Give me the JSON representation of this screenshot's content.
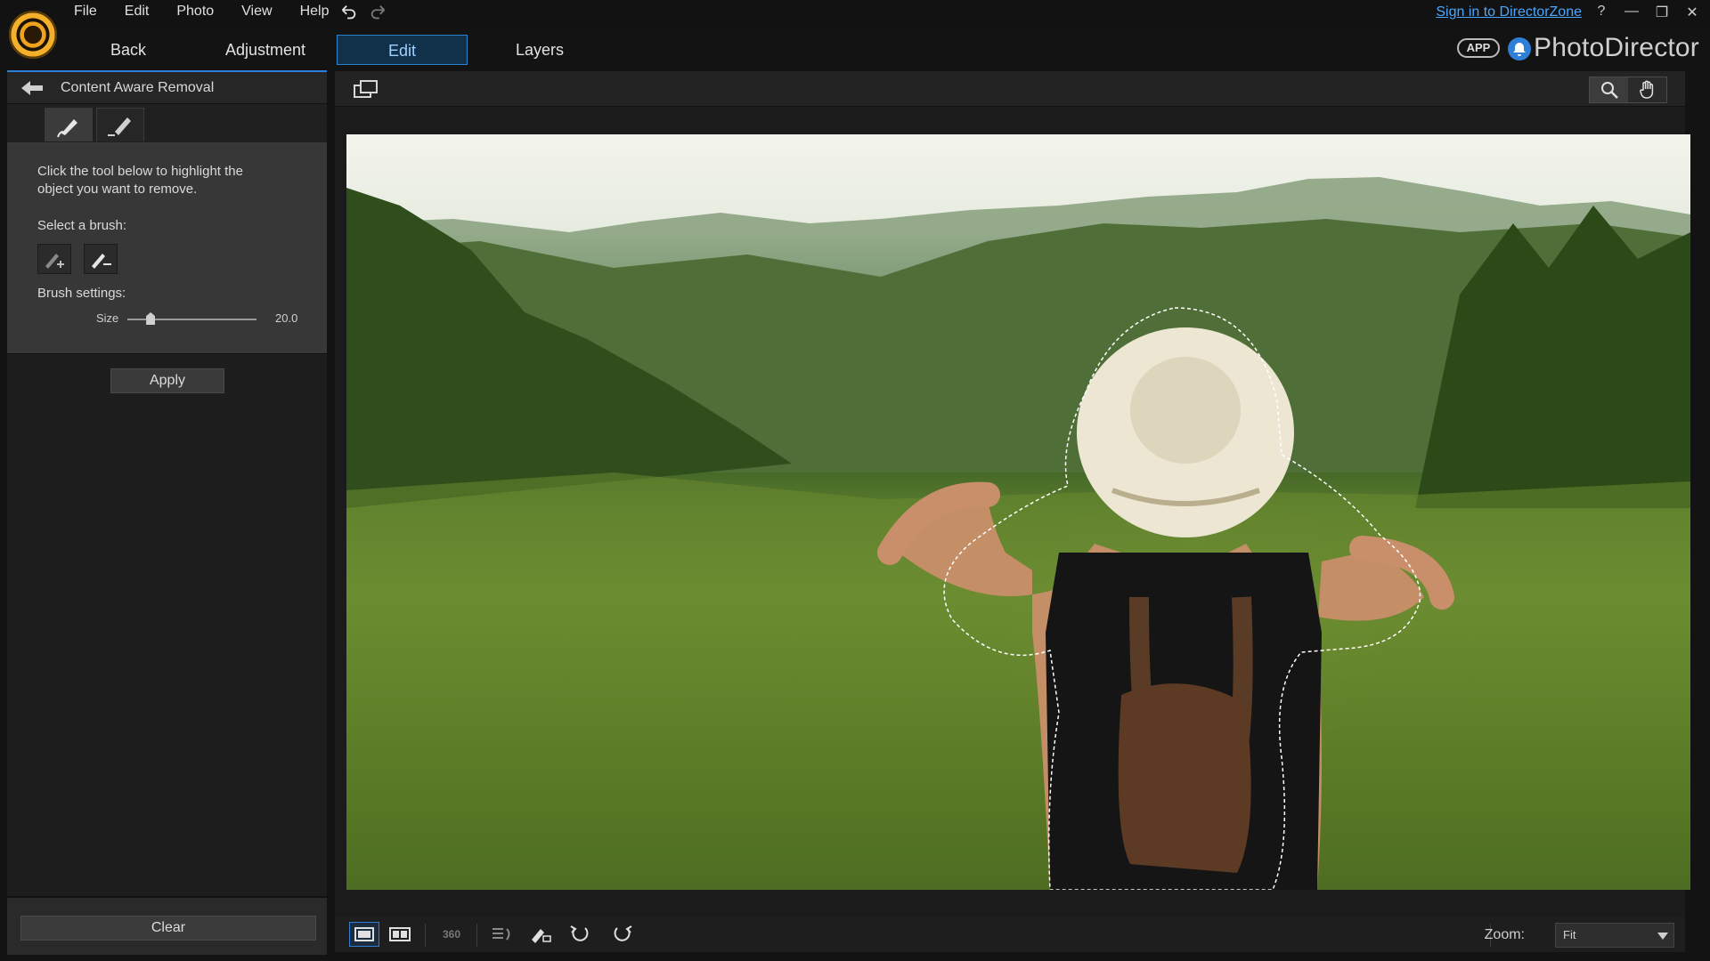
{
  "menu": [
    "File",
    "Edit",
    "Photo",
    "View",
    "Help"
  ],
  "signin": "Sign in to DirectorZone",
  "window_controls": [
    "?",
    "—",
    "❐",
    "✕"
  ],
  "tabs": [
    {
      "label": "Back"
    },
    {
      "label": "Adjustment"
    },
    {
      "label": "Edit"
    },
    {
      "label": "Layers"
    }
  ],
  "active_tab": "Edit",
  "app_badge": "APP",
  "brand": "PhotoDirector",
  "panel": {
    "title": "Content Aware Removal",
    "instructions": "Click the tool below to highlight the object you want to remove.",
    "select_brush": "Select a brush:",
    "brush_settings": "Brush settings:",
    "size_label": "Size",
    "size_value": "20.0",
    "size_fraction": 0.18,
    "apply": "Apply",
    "clear": "Clear"
  },
  "bottom_toolbar": {
    "zoom_label": "Zoom:",
    "zoom_value": "Fit",
    "icon_360": "360"
  },
  "colors": {
    "accent": "#2f7fd6",
    "link": "#4aa6ff",
    "panel_bg": "#373737"
  },
  "icons": [
    "logo-icon",
    "undo-icon",
    "redo-icon",
    "help-icon",
    "minimize-icon",
    "restore-icon",
    "close-icon",
    "bell-icon",
    "back-arrow-icon",
    "brush-add-icon",
    "brush-remove-icon",
    "compare-icon",
    "zoom-icon",
    "hand-icon",
    "single-view-icon",
    "split-view-icon",
    "360-icon",
    "layers-rotate-icon",
    "edit-brush-icon",
    "rotate-left-icon",
    "rotate-right-icon",
    "chevron-down-icon"
  ]
}
